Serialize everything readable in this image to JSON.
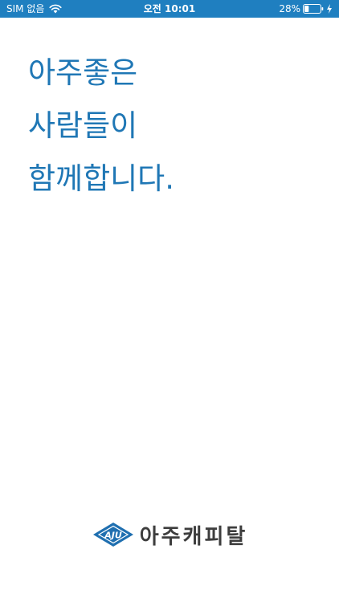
{
  "status_bar": {
    "carrier": "SIM 없음",
    "time": "오전 10:01",
    "battery_percent": "28%",
    "battery_level": 0.28,
    "background_color": "#1f7fc0"
  },
  "slogan": {
    "lines": [
      "아주좋은",
      "사람들이",
      "함께합니다."
    ],
    "color": "#1f77b5"
  },
  "brand": {
    "name": "아주캐피탈",
    "logo_text": "AJU",
    "mark_color": "#1f6fb0"
  }
}
